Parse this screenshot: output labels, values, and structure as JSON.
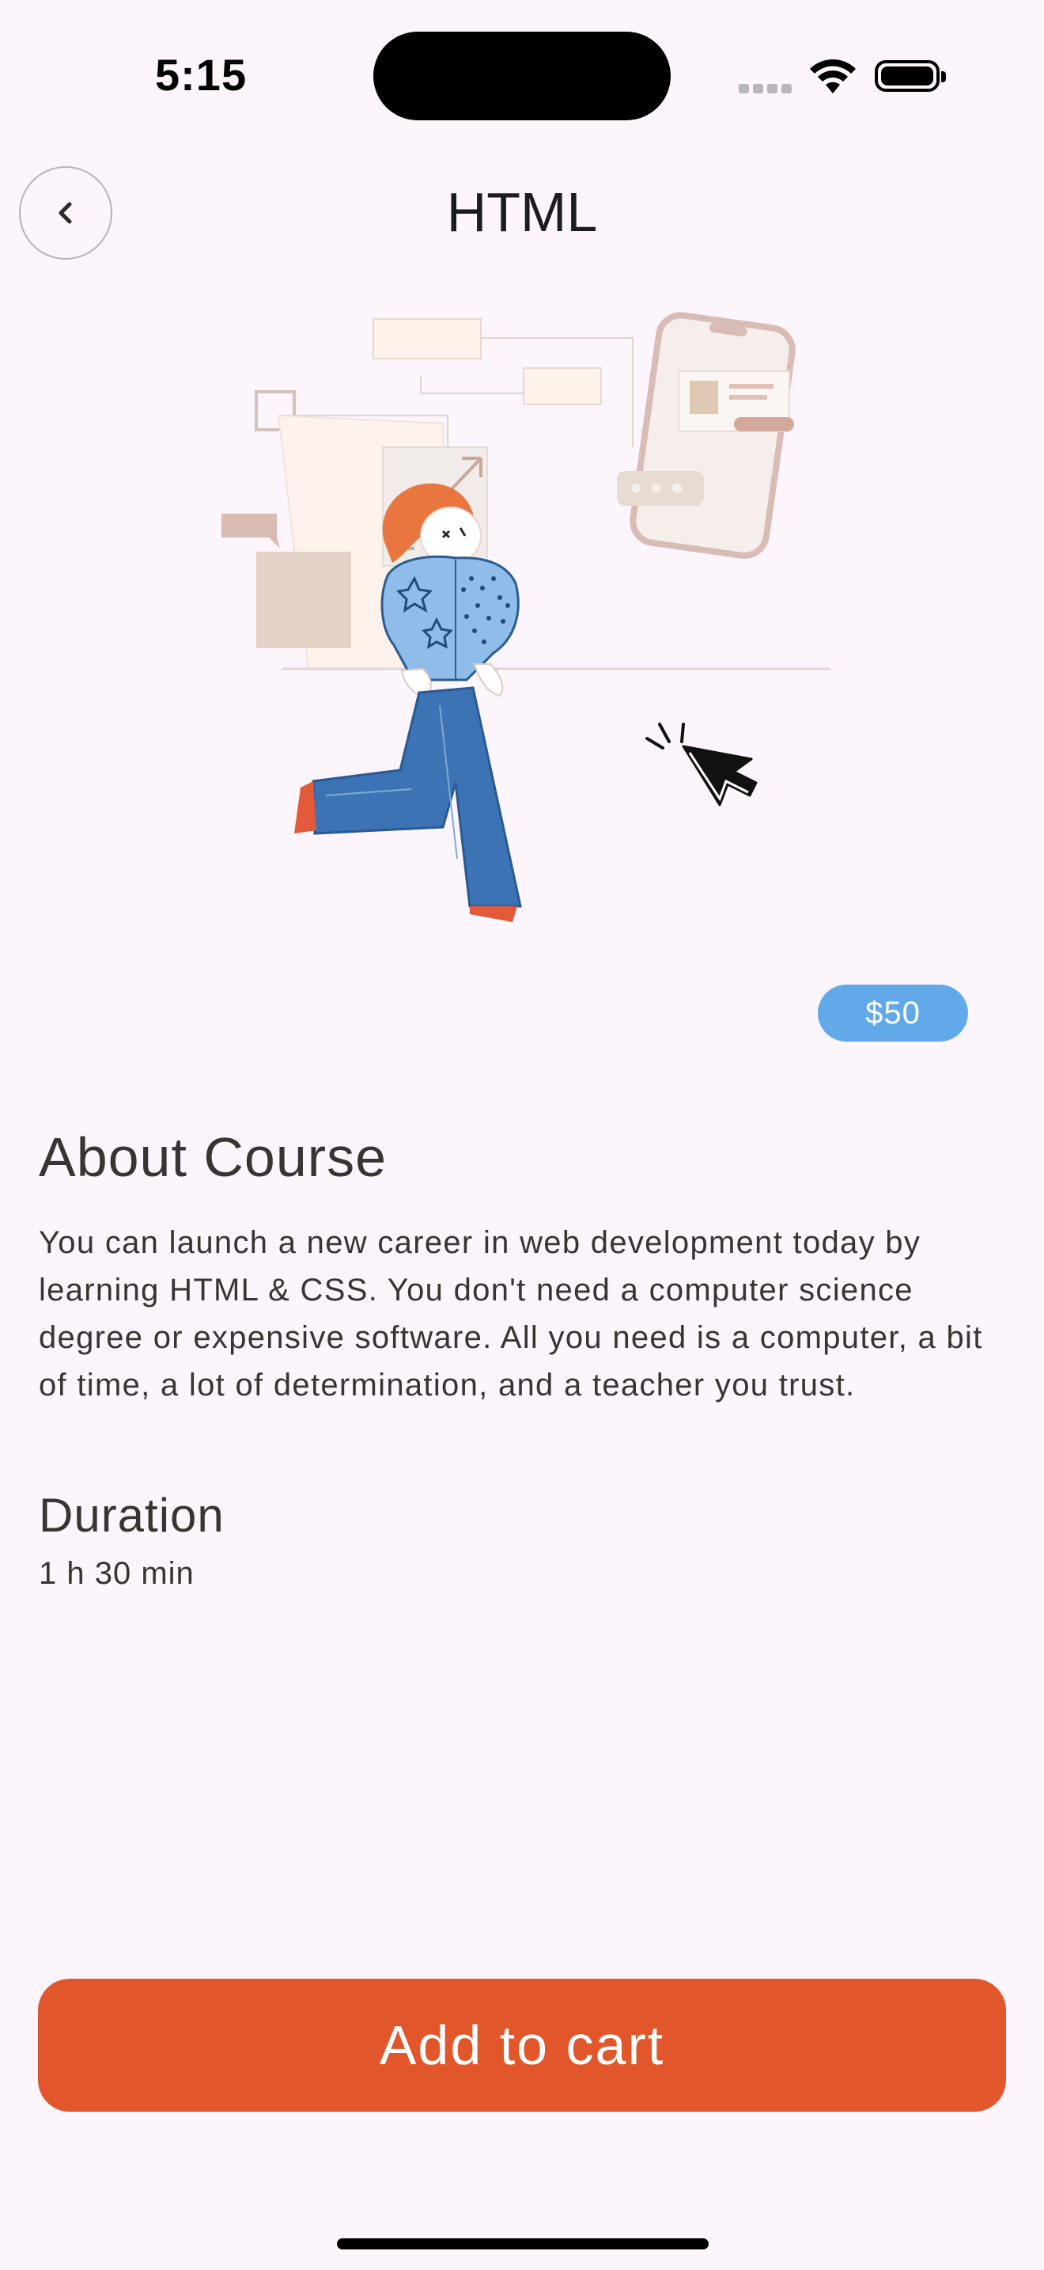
{
  "status_bar": {
    "time": "5:15",
    "icons": [
      "cellular-signal-icon",
      "wifi-icon",
      "battery-icon"
    ]
  },
  "header": {
    "title": "HTML",
    "back_icon": "chevron-left-icon"
  },
  "hero": {
    "illustration": "woman-running-web-design-illustration"
  },
  "course": {
    "price": "$50",
    "about_title": "About Course",
    "about_text": "You can launch a new career in web development today by learning HTML & CSS. You don't need a computer science degree or expensive software. All you need is a computer, a bit of time, a lot of determination, and a teacher you trust.",
    "duration_title": "Duration",
    "duration_value": "1 h 30 min"
  },
  "actions": {
    "add_to_cart_label": "Add to cart"
  },
  "colors": {
    "background": "#fcf5fb",
    "accent": "#e2562b",
    "price_badge": "#62a9ea",
    "text": "#3a3333"
  }
}
